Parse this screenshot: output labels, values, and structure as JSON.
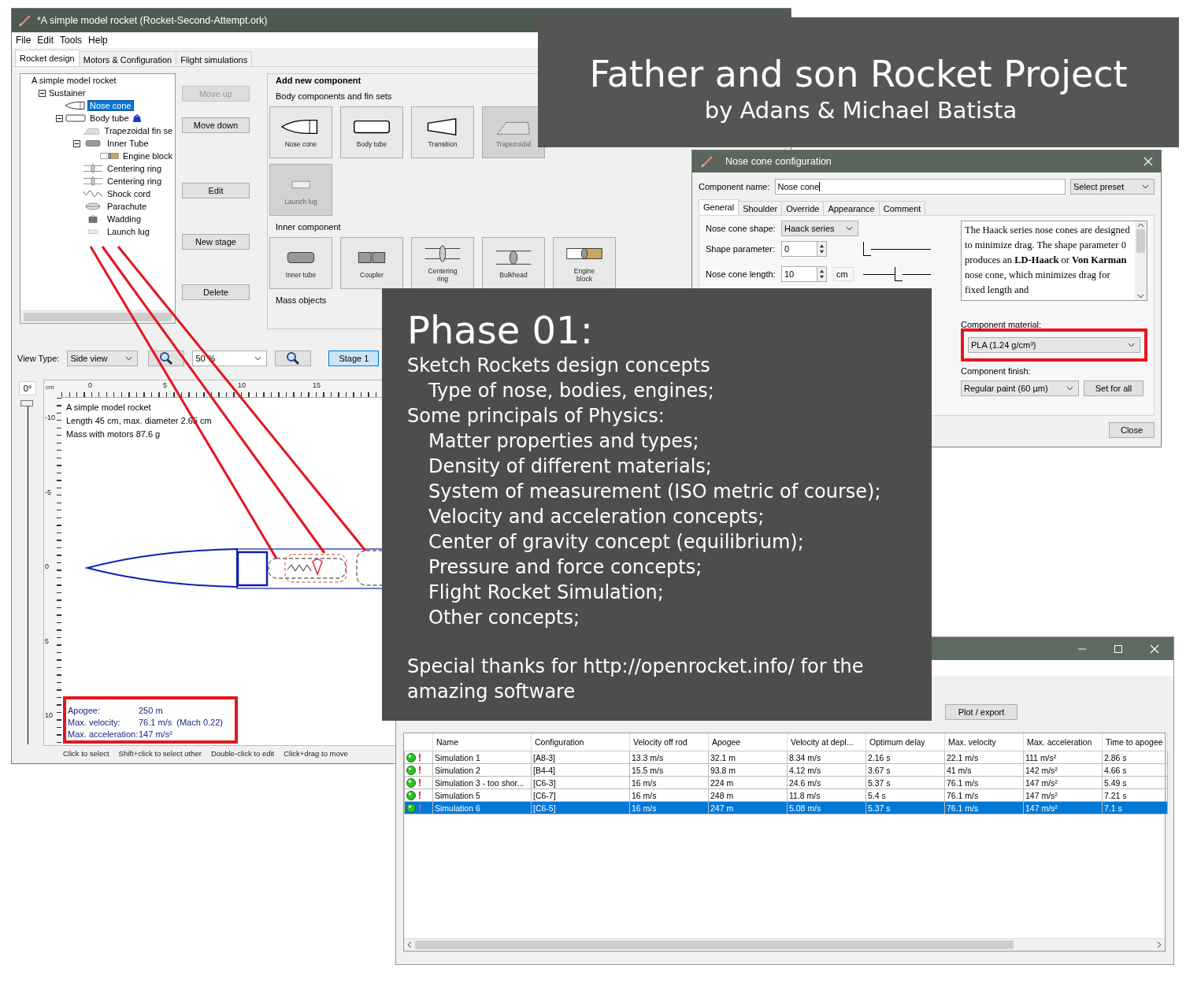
{
  "main_window": {
    "title": "*A simple model rocket (Rocket-Second-Attempt.ork)",
    "menu": [
      "File",
      "Edit",
      "Tools",
      "Help"
    ],
    "tabs": [
      {
        "label": "Rocket design",
        "selected": true
      },
      {
        "label": "Motors & Configuration",
        "selected": false
      },
      {
        "label": "Flight simulations",
        "selected": false
      }
    ],
    "tree": {
      "label": "A simple model rocket",
      "selected": false,
      "children": [
        {
          "label": "Sustainer",
          "expanded": true,
          "selected": false,
          "children": [
            {
              "label": "Nose cone",
              "kind": "nose",
              "selected": true
            },
            {
              "label": "Body tube",
              "kind": "tube",
              "expanded": true,
              "motor_mount": true,
              "selected": false,
              "children": [
                {
                  "label": "Trapezoidal fin se",
                  "kind": "fin",
                  "selected": false
                },
                {
                  "label": "Inner Tube",
                  "kind": "inner",
                  "expanded": true,
                  "selected": false,
                  "children": [
                    {
                      "label": "Engine block",
                      "kind": "engine",
                      "selected": false
                    }
                  ]
                },
                {
                  "label": "Centering ring",
                  "kind": "ring",
                  "selected": false
                },
                {
                  "label": "Centering ring",
                  "kind": "ring",
                  "selected": false
                },
                {
                  "label": "Shock cord",
                  "kind": "cord",
                  "selected": false
                },
                {
                  "label": "Parachute",
                  "kind": "chute",
                  "selected": false
                },
                {
                  "label": "Wadding",
                  "kind": "wadding",
                  "selected": false
                },
                {
                  "label": "Launch lug",
                  "kind": "lug",
                  "selected": false
                }
              ]
            }
          ]
        }
      ]
    },
    "tree_buttons": [
      {
        "label": "Move up",
        "disabled": true
      },
      {
        "label": "Move down",
        "disabled": false
      },
      {
        "label": "Edit",
        "disabled": false
      },
      {
        "label": "New stage",
        "disabled": false
      },
      {
        "label": "Delete",
        "disabled": false
      }
    ],
    "add_component": {
      "title": "Add new component",
      "groups": [
        {
          "title": "Body components and fin sets",
          "rows": [
            [
              {
                "label": "Nose cone",
                "kind": "nose",
                "disabled": false
              },
              {
                "label": "Body tube",
                "kind": "tube",
                "disabled": false
              },
              {
                "label": "Transition",
                "kind": "transition",
                "disabled": false
              },
              {
                "label": "Trapezoidal",
                "kind": "fin",
                "disabled": true
              }
            ],
            [
              {
                "label": "Launch lug",
                "kind": "lug",
                "disabled": true
              }
            ]
          ]
        },
        {
          "title": "Inner component",
          "rows": [
            [
              {
                "label": "Inner tube",
                "kind": "inner",
                "disabled": false
              },
              {
                "label": "Coupler",
                "kind": "coupler",
                "disabled": false
              },
              {
                "label": "Centering ring",
                "kind": "ring",
                "disabled": false
              },
              {
                "label": "Bulkhead",
                "kind": "bulkhead",
                "disabled": false
              },
              {
                "label": "Engine block",
                "kind": "engine",
                "disabled": false
              }
            ]
          ]
        },
        {
          "title": "Mass objects"
        }
      ]
    },
    "view": {
      "label": "View Type:",
      "view_type": "Side view",
      "zoom": "50 %",
      "stage": {
        "label": "Stage 1",
        "selected": true
      }
    },
    "canvas": {
      "angle": "0°",
      "level": 0,
      "unit": "cm",
      "x_ticks": [
        "0",
        "5",
        "10",
        "15"
      ],
      "y_ticks": [
        "-10",
        "-5",
        "0",
        "5",
        "10"
      ],
      "info": [
        "A simple model rocket",
        "Length 45 cm, max. diameter 2.65 cm",
        "Mass with motors 87.6 g"
      ],
      "stats": [
        {
          "label": "Apogee:",
          "value": "250 m"
        },
        {
          "label": "Max. velocity:",
          "value": "76.1 m/s  (Mach 0.22)"
        },
        {
          "label": "Max. acceleration:",
          "value": "147 m/s²"
        }
      ]
    },
    "hints": [
      "Click to select",
      "Shift+click to select other",
      "Double-click to edit",
      "Click+drag to move"
    ]
  },
  "title_overlay": {
    "title": "Father and son Rocket Project",
    "subtitle": "by Adans & Michael Batista"
  },
  "nose_cone_dialog": {
    "title": "Nose cone configuration",
    "name_label": "Component name:",
    "name": "Nose cone",
    "preset": "Select preset",
    "tabs": [
      {
        "label": "General",
        "selected": true
      },
      {
        "label": "Shoulder",
        "selected": false
      },
      {
        "label": "Override",
        "selected": false
      },
      {
        "label": "Appearance",
        "selected": false
      },
      {
        "label": "Comment",
        "selected": false
      }
    ],
    "fields": [
      {
        "label": "Nose cone shape:",
        "kind": "dropdown",
        "value": "Haack series"
      },
      {
        "label": "Shape parameter:",
        "kind": "spinner",
        "value": "0",
        "level": 0
      },
      {
        "label": "Nose cone length:",
        "kind": "spinner",
        "value": "10",
        "unit": "cm",
        "level": 0.52
      }
    ],
    "description": "The Haack series nose cones are designed to minimize drag. The shape parameter 0 produces an **LD-Haack** or **Von Karman** nose cone, which minimizes drag for fixed length and",
    "material_label": "Component material:",
    "material": "PLA (1.24 g/cm³)",
    "finish_label": "Component finish:",
    "finish": "Regular paint (60 µm)",
    "set_for_all": "Set for all",
    "close": "Close"
  },
  "phase_overlay": {
    "title": "Phase 01:",
    "lines": [
      {
        "text": "Sketch Rockets design concepts",
        "kind": "topic"
      },
      {
        "text": "Type of nose, bodies, engines;",
        "kind": "item"
      },
      {
        "text": "Some principals of Physics:",
        "kind": "topic"
      },
      {
        "text": "Matter properties and types;",
        "kind": "item"
      },
      {
        "text": "Density of different materials;",
        "kind": "item"
      },
      {
        "text": "System of measurement (ISO metric of course);",
        "kind": "item"
      },
      {
        "text": "Velocity and acceleration concepts;",
        "kind": "item"
      },
      {
        "text": "Center of gravity concept (equilibrium);",
        "kind": "item"
      },
      {
        "text": "Pressure and force concepts;",
        "kind": "item"
      },
      {
        "text": "Flight Rocket Simulation;",
        "kind": "item"
      },
      {
        "text": "Other concepts;",
        "kind": "item"
      }
    ],
    "thanks": "Special thanks for http://openrocket.info/ for the amazing software"
  },
  "simulations_window": {
    "plot_button": "Plot / export",
    "columns": [
      "Name",
      "Configuration",
      "Velocity off rod",
      "Apogee",
      "Velocity at depl...",
      "Optimum delay",
      "Max. velocity",
      "Max. acceleration",
      "Time to apogee"
    ],
    "rows": [
      {
        "warning": "!",
        "selected": false,
        "cells": [
          "Simulation 1",
          "[A8-3]",
          "13.3 m/s",
          "32.1 m",
          "8.34 m/s",
          "2.16 s",
          "22.1 m/s",
          "111 m/s²",
          "2.86 s"
        ]
      },
      {
        "warning": "!",
        "selected": false,
        "cells": [
          "Simulation 2",
          "[B4-4]",
          "15.5 m/s",
          "93.8 m",
          "4.12 m/s",
          "3.67 s",
          "41 m/s",
          "142 m/s²",
          "4.66 s"
        ]
      },
      {
        "warning": "!",
        "selected": false,
        "cells": [
          "Simulation 3 - too shor...",
          "[C6-3]",
          "16 m/s",
          "224 m",
          "24.6 m/s",
          "5.37 s",
          "76.1 m/s",
          "147 m/s²",
          "5.49 s"
        ]
      },
      {
        "warning": "!",
        "selected": false,
        "cells": [
          "Simulation 5",
          "[C6-7]",
          "16 m/s",
          "248 m",
          "11.8 m/s",
          "5.4 s",
          "76.1 m/s",
          "147 m/s²",
          "7.21 s"
        ]
      },
      {
        "warning": "!",
        "selected": true,
        "cells": [
          "Simulation 6",
          "[C6-5]",
          "16 m/s",
          "247 m",
          "5.08 m/s",
          "5.37 s",
          "76.1 m/s",
          "147 m/s²",
          "7.1 s"
        ]
      }
    ]
  }
}
